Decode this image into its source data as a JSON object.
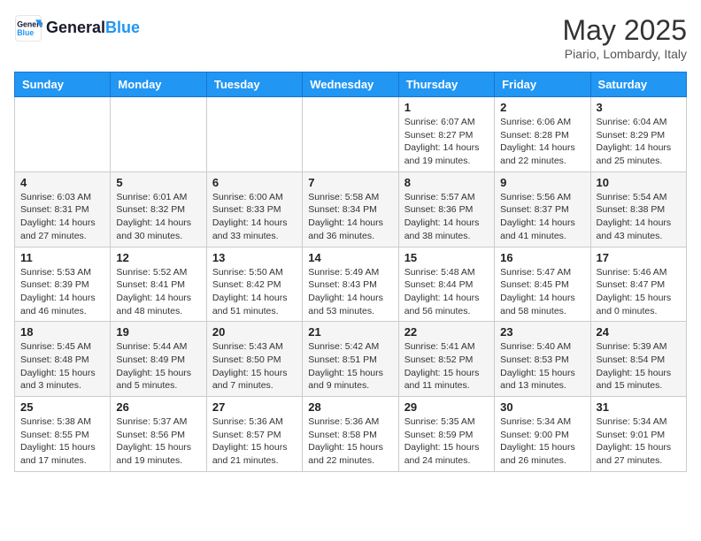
{
  "header": {
    "logo_line1": "General",
    "logo_line2": "Blue",
    "month": "May 2025",
    "location": "Piario, Lombardy, Italy"
  },
  "days_of_week": [
    "Sunday",
    "Monday",
    "Tuesday",
    "Wednesday",
    "Thursday",
    "Friday",
    "Saturday"
  ],
  "weeks": [
    [
      {
        "day": "",
        "info": ""
      },
      {
        "day": "",
        "info": ""
      },
      {
        "day": "",
        "info": ""
      },
      {
        "day": "",
        "info": ""
      },
      {
        "day": "1",
        "info": "Sunrise: 6:07 AM\nSunset: 8:27 PM\nDaylight: 14 hours\nand 19 minutes."
      },
      {
        "day": "2",
        "info": "Sunrise: 6:06 AM\nSunset: 8:28 PM\nDaylight: 14 hours\nand 22 minutes."
      },
      {
        "day": "3",
        "info": "Sunrise: 6:04 AM\nSunset: 8:29 PM\nDaylight: 14 hours\nand 25 minutes."
      }
    ],
    [
      {
        "day": "4",
        "info": "Sunrise: 6:03 AM\nSunset: 8:31 PM\nDaylight: 14 hours\nand 27 minutes."
      },
      {
        "day": "5",
        "info": "Sunrise: 6:01 AM\nSunset: 8:32 PM\nDaylight: 14 hours\nand 30 minutes."
      },
      {
        "day": "6",
        "info": "Sunrise: 6:00 AM\nSunset: 8:33 PM\nDaylight: 14 hours\nand 33 minutes."
      },
      {
        "day": "7",
        "info": "Sunrise: 5:58 AM\nSunset: 8:34 PM\nDaylight: 14 hours\nand 36 minutes."
      },
      {
        "day": "8",
        "info": "Sunrise: 5:57 AM\nSunset: 8:36 PM\nDaylight: 14 hours\nand 38 minutes."
      },
      {
        "day": "9",
        "info": "Sunrise: 5:56 AM\nSunset: 8:37 PM\nDaylight: 14 hours\nand 41 minutes."
      },
      {
        "day": "10",
        "info": "Sunrise: 5:54 AM\nSunset: 8:38 PM\nDaylight: 14 hours\nand 43 minutes."
      }
    ],
    [
      {
        "day": "11",
        "info": "Sunrise: 5:53 AM\nSunset: 8:39 PM\nDaylight: 14 hours\nand 46 minutes."
      },
      {
        "day": "12",
        "info": "Sunrise: 5:52 AM\nSunset: 8:41 PM\nDaylight: 14 hours\nand 48 minutes."
      },
      {
        "day": "13",
        "info": "Sunrise: 5:50 AM\nSunset: 8:42 PM\nDaylight: 14 hours\nand 51 minutes."
      },
      {
        "day": "14",
        "info": "Sunrise: 5:49 AM\nSunset: 8:43 PM\nDaylight: 14 hours\nand 53 minutes."
      },
      {
        "day": "15",
        "info": "Sunrise: 5:48 AM\nSunset: 8:44 PM\nDaylight: 14 hours\nand 56 minutes."
      },
      {
        "day": "16",
        "info": "Sunrise: 5:47 AM\nSunset: 8:45 PM\nDaylight: 14 hours\nand 58 minutes."
      },
      {
        "day": "17",
        "info": "Sunrise: 5:46 AM\nSunset: 8:47 PM\nDaylight: 15 hours\nand 0 minutes."
      }
    ],
    [
      {
        "day": "18",
        "info": "Sunrise: 5:45 AM\nSunset: 8:48 PM\nDaylight: 15 hours\nand 3 minutes."
      },
      {
        "day": "19",
        "info": "Sunrise: 5:44 AM\nSunset: 8:49 PM\nDaylight: 15 hours\nand 5 minutes."
      },
      {
        "day": "20",
        "info": "Sunrise: 5:43 AM\nSunset: 8:50 PM\nDaylight: 15 hours\nand 7 minutes."
      },
      {
        "day": "21",
        "info": "Sunrise: 5:42 AM\nSunset: 8:51 PM\nDaylight: 15 hours\nand 9 minutes."
      },
      {
        "day": "22",
        "info": "Sunrise: 5:41 AM\nSunset: 8:52 PM\nDaylight: 15 hours\nand 11 minutes."
      },
      {
        "day": "23",
        "info": "Sunrise: 5:40 AM\nSunset: 8:53 PM\nDaylight: 15 hours\nand 13 minutes."
      },
      {
        "day": "24",
        "info": "Sunrise: 5:39 AM\nSunset: 8:54 PM\nDaylight: 15 hours\nand 15 minutes."
      }
    ],
    [
      {
        "day": "25",
        "info": "Sunrise: 5:38 AM\nSunset: 8:55 PM\nDaylight: 15 hours\nand 17 minutes."
      },
      {
        "day": "26",
        "info": "Sunrise: 5:37 AM\nSunset: 8:56 PM\nDaylight: 15 hours\nand 19 minutes."
      },
      {
        "day": "27",
        "info": "Sunrise: 5:36 AM\nSunset: 8:57 PM\nDaylight: 15 hours\nand 21 minutes."
      },
      {
        "day": "28",
        "info": "Sunrise: 5:36 AM\nSunset: 8:58 PM\nDaylight: 15 hours\nand 22 minutes."
      },
      {
        "day": "29",
        "info": "Sunrise: 5:35 AM\nSunset: 8:59 PM\nDaylight: 15 hours\nand 24 minutes."
      },
      {
        "day": "30",
        "info": "Sunrise: 5:34 AM\nSunset: 9:00 PM\nDaylight: 15 hours\nand 26 minutes."
      },
      {
        "day": "31",
        "info": "Sunrise: 5:34 AM\nSunset: 9:01 PM\nDaylight: 15 hours\nand 27 minutes."
      }
    ]
  ]
}
